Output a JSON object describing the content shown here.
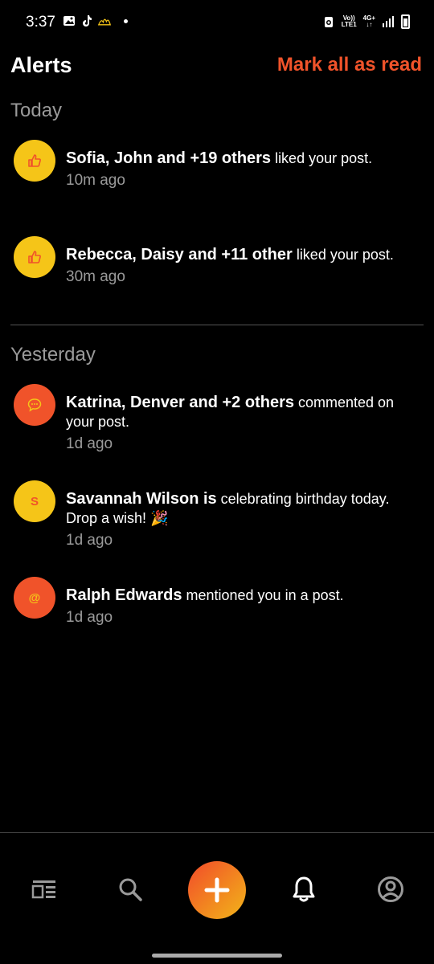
{
  "status_bar": {
    "time": "3:37",
    "network_top": "Vo))",
    "network_bottom": "LTE1",
    "data_top": "4G+",
    "data_bottom": "↓↑"
  },
  "header": {
    "title": "Alerts",
    "mark_all_label": "Mark all as read"
  },
  "sections": {
    "today_label": "Today",
    "yesterday_label": "Yesterday"
  },
  "alerts": [
    {
      "names": "Sofia, John and +19 others",
      "action": " liked your post.",
      "time": "10m ago",
      "icon": "thumbs-up-icon",
      "color": "#f5c518"
    },
    {
      "names": "Rebecca, Daisy and +11 other",
      "action": " liked your post.",
      "time": "30m ago",
      "icon": "thumbs-up-icon",
      "color": "#f5c518"
    },
    {
      "names": "Katrina, Denver and +2 others",
      "action": " commented on your post.",
      "time": "1d ago",
      "icon": "comment-icon",
      "color": "#f0532a"
    },
    {
      "names": "Savannah Wilson is",
      "action": " celebrating birthday today. Drop a wish! 🎉",
      "time": "1d ago",
      "icon": "birthday-icon",
      "glyph": "S",
      "color": "#f5c518"
    },
    {
      "names": "Ralph Edwards",
      "action": " mentioned you in a post.",
      "time": "1d ago",
      "icon": "mention-icon",
      "glyph": "@",
      "color": "#f0532a"
    }
  ],
  "accent_color": "#f0532a",
  "nav": {
    "items": [
      "feed-icon",
      "search-icon",
      "add-icon",
      "bell-icon",
      "profile-icon"
    ],
    "active": "bell-icon"
  }
}
